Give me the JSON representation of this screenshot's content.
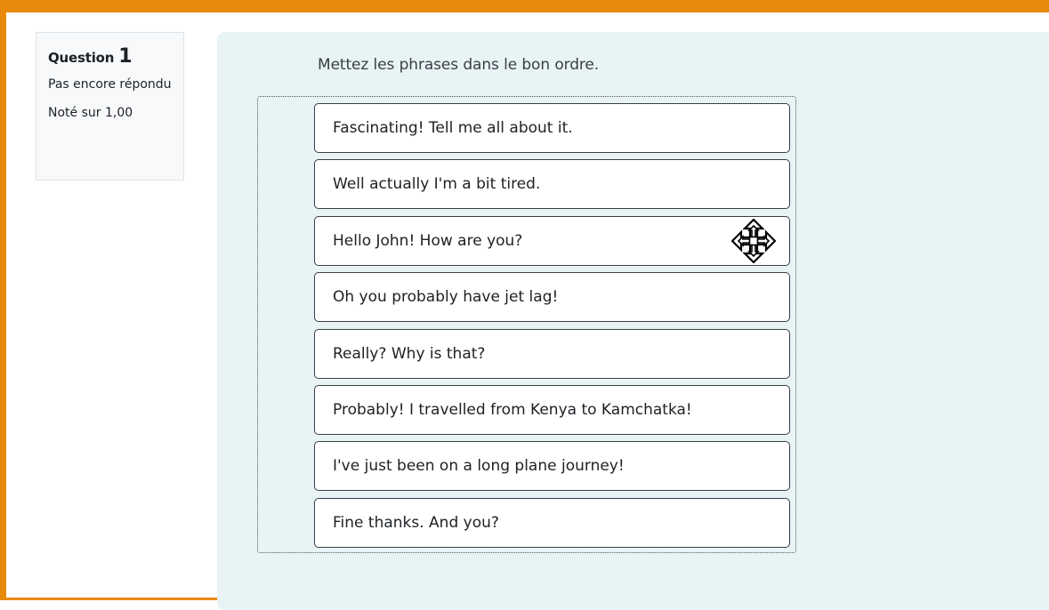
{
  "question": {
    "label": "Question",
    "number": "1",
    "state": "Pas encore répondu",
    "grade": "Noté sur 1,00"
  },
  "prompt": "Mettez les phrases dans le bon ordre.",
  "items": [
    "Fascinating! Tell me all about it.",
    "Well actually I'm a bit tired.",
    "Hello John! How are you?",
    "Oh you probably have jet lag!",
    "Really? Why is that?",
    "Probably! I travelled from Kenya to Kamchatka!",
    "I've just been on a long plane journey!",
    "Fine thanks. And you?"
  ],
  "cursor": {
    "icon": "move-cursor-icon"
  },
  "colors": {
    "accent_border": "#e8890c",
    "content_background": "#e7f3f5",
    "info_background": "#f8f9fa"
  }
}
